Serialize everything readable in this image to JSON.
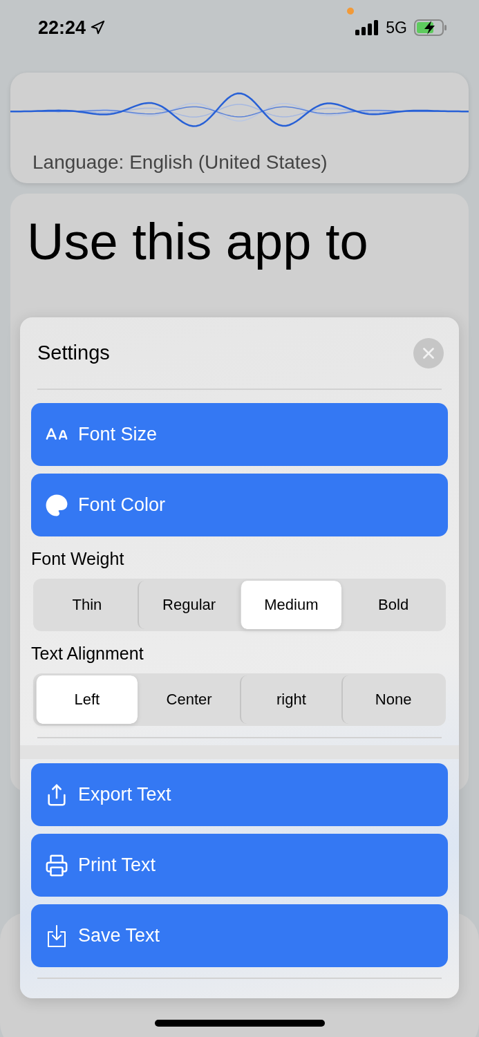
{
  "status_bar": {
    "time": "22:24",
    "network": "5G",
    "battery_charging": true
  },
  "language_card": {
    "label": "Language: English (United States)"
  },
  "content": {
    "headline": "Use this app to"
  },
  "settings": {
    "title": "Settings",
    "top_actions": [
      {
        "kind": "font_size",
        "label": "Font Size"
      },
      {
        "kind": "palette",
        "label": "Font Color"
      }
    ],
    "font_weight": {
      "label": "Font Weight",
      "options": [
        {
          "label": "Thin",
          "selected": false
        },
        {
          "label": "Regular",
          "selected": false
        },
        {
          "label": "Medium",
          "selected": true
        },
        {
          "label": "Bold",
          "selected": false
        }
      ]
    },
    "text_alignment": {
      "label": "Text Alignment",
      "options": [
        {
          "label": "Left",
          "selected": true
        },
        {
          "label": "Center",
          "selected": false
        },
        {
          "label": "right",
          "selected": false
        },
        {
          "label": "None",
          "selected": false
        }
      ]
    },
    "bottom_actions": [
      {
        "kind": "export",
        "label": "Export Text"
      },
      {
        "kind": "print",
        "label": "Print Text"
      },
      {
        "kind": "save",
        "label": "Save Text"
      }
    ]
  }
}
